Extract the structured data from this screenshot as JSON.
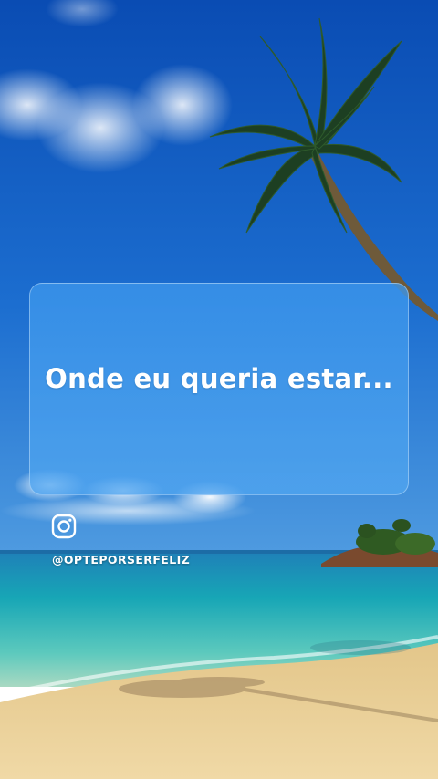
{
  "post": {
    "headline": "Onde eu queria estar...",
    "handle": "@OPTEPORSERFELIZ",
    "icon": "instagram-icon"
  },
  "colors": {
    "sky_top": "#0d4fb5",
    "sky_bottom": "#2d7fd6",
    "sea": "#1aa9b5",
    "sand": "#e9cf97",
    "card": "#3c96eb"
  }
}
